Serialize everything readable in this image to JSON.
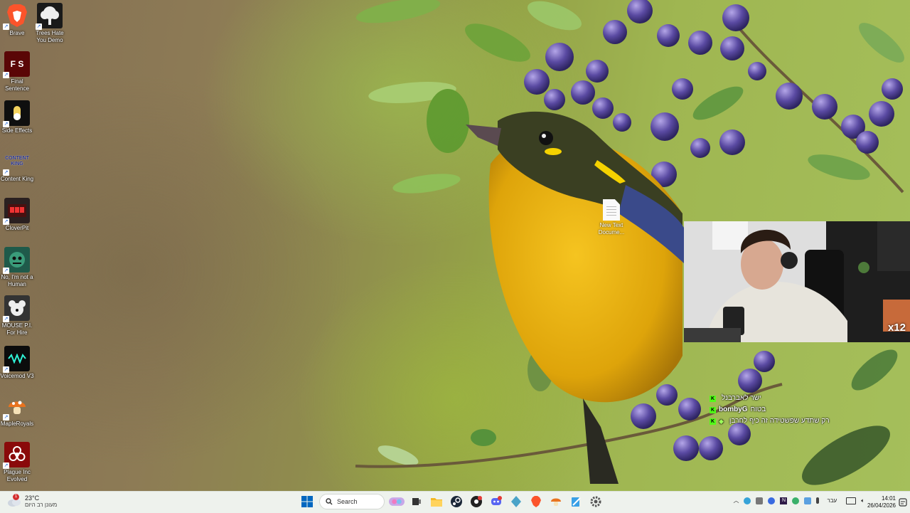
{
  "desktop": {
    "icons": [
      {
        "label": "Brave",
        "icon": "brave-lion-icon"
      },
      {
        "label": "Trees Hate You Demo",
        "icon": "tree-icon"
      },
      {
        "label": "Final Sentence",
        "icon": "final-sentence-icon"
      },
      {
        "label": "Side Effects",
        "icon": "pill-icon"
      },
      {
        "label": "Content King",
        "icon": "content-king-icon"
      },
      {
        "label": "CloverPit",
        "icon": "cloverpit-icon"
      },
      {
        "label": "No, I'm not a Human",
        "icon": "creature-icon"
      },
      {
        "label": "MOUSE P.I. For Hire",
        "icon": "mouse-pi-icon"
      },
      {
        "label": "Voicemod V3",
        "icon": "voicemod-icon"
      },
      {
        "label": "MapleRoyals",
        "icon": "mushroom-icon"
      },
      {
        "label": "Plague Inc Evolved",
        "icon": "biohazard-icon"
      }
    ],
    "file": {
      "label": "New Text Docume...",
      "icon": "text-file-icon"
    },
    "final_sentence_text": "F S",
    "content_king_text": "CONTENT KING"
  },
  "webcam": {
    "badge": "x12"
  },
  "chat": {
    "messages": [
      {
        "user": "",
        "text": "ישר לאברבנל",
        "user_color": "#ff7ab6"
      },
      {
        "user": "bombyG",
        "text": "בטוח",
        "user_color": "#ffffff"
      },
      {
        "user": "",
        "text": "רק שתדע שפשטידה זה כיף לחרבן",
        "user_color": "#9dff5a"
      }
    ]
  },
  "taskbar": {
    "weather": {
      "temp": "23°C",
      "condition": "מעונן רב היום",
      "alert": "1"
    },
    "search_label": "Search",
    "lang": "עבר",
    "time": "14:01",
    "date": "26/04/2026",
    "colors": {
      "accent": "#0067c0",
      "brave": "#fb542b",
      "discord": "#5865f2"
    }
  }
}
